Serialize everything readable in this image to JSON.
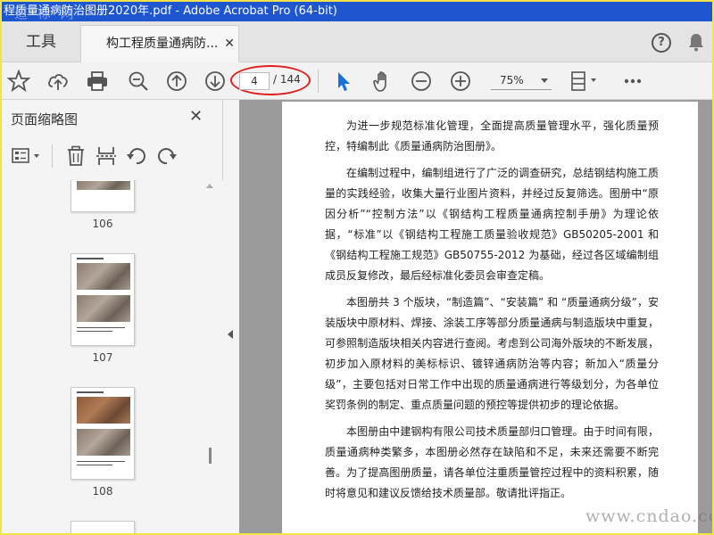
{
  "window": {
    "title": "程质量通病防治图册2020年.pdf - Adobe Acrobat Pro (64-bit)",
    "watermark_top": "道 标 网",
    "watermark_bottom": "www.cndao.com"
  },
  "tabs": {
    "tools_label": "工具",
    "document_label": "构工程质量通病防...",
    "close_glyph": "✕"
  },
  "header_icons": [
    "help-icon",
    "notification-bell-icon"
  ],
  "toolbar": {
    "icons": [
      "bookmark-star-icon",
      "cloud-upload-icon",
      "print-icon",
      "zoom-out-magnifier-icon",
      "page-up-icon",
      "page-down-icon",
      "select-pointer-icon",
      "hand-tool-icon",
      "zoom-out-icon",
      "zoom-in-icon",
      "page-fit-icon",
      "more-options-icon"
    ],
    "current_page": "4",
    "total_pages": "/ 144",
    "zoom_level": "75%",
    "highlight_color": "#e02020"
  },
  "sidebar": {
    "title": "页面缩略图",
    "close_glyph": "✕",
    "tool_icons": [
      "thumbnail-options-icon",
      "delete-page-icon",
      "insert-page-icon",
      "rotate-left-icon",
      "rotate-right-icon"
    ],
    "thumbnails": [
      {
        "page": "106"
      },
      {
        "page": "107"
      },
      {
        "page": "108"
      }
    ]
  },
  "document": {
    "paragraphs": [
      "为进一步规范标准化管理，全面提高质量管理水平，强化质量预控，特编制此《质量通病防治图册》。",
      "在编制过程中，编制组进行了广泛的调查研究，总结钢结构施工质量的实践经验，收集大量行业图片资料，并经过反复筛选。图册中“原因分析”“控制方法”以《钢结构工程质量通病控制手册》为理论依据，“标准”以《钢结构工程施工质量验收规范》GB50205-2001 和《钢结构工程施工规范》GB50755-2012 为基础，经过各区域编制组成员反复修改，最后经标准化委员会审查定稿。",
      "本图册共 3 个版块，“制造篇”、“安装篇” 和 “质量通病分级”，安装版块中原材料、焊接、涂装工序等部分质量通病与制造版块中重复，可参照制造版块相关内容进行查阅。考虑到公司海外版块的不断发展，初步加入原材料的美标标识、镀锌通病防治等内容；新加入“质量分级”，主要包括对日常工作中出现的质量通病进行等级划分，为各单位奖罚条例的制定、重点质量问题的预控等提供初步的理论依据。",
      "本图册由中建钢构有限公司技术质量部归口管理。由于时间有限，质量通病种类繁多，本图册必然存在缺陷和不足，未来还需要不断完善。为了提高图册质量，请各单位注重质量管控过程中的资料积累，随时将意见和建议反馈给技术质量部。敬请批评指正。"
    ]
  },
  "colors": {
    "titlebar": "#1e56d0",
    "frame_border": "#f4e24a",
    "pointer_accent": "#1a6fd8"
  }
}
